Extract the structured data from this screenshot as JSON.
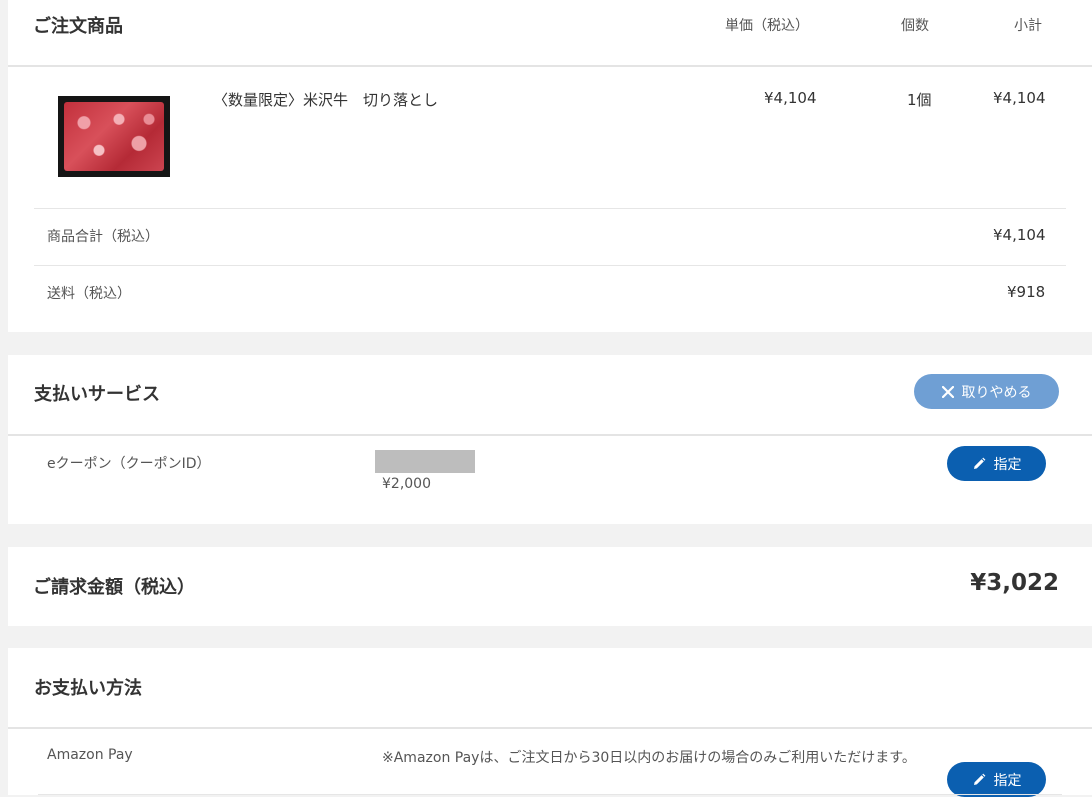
{
  "order_items": {
    "title": "ご注文商品",
    "col_unit_price": "単価（税込）",
    "col_qty": "個数",
    "col_subtotal": "小計",
    "item": {
      "name": "〈数量限定〉米沢牛　切り落とし",
      "unit_price": "¥4,104",
      "qty": "1個",
      "subtotal": "¥4,104"
    },
    "goods_total_label": "商品合計（税込）",
    "goods_total_value": "¥4,104",
    "shipping_label": "送料（税込）",
    "shipping_value": "¥918"
  },
  "payment_service": {
    "title": "支払いサービス",
    "cancel_label": "取りやめる",
    "coupon_label": "eクーポン（クーポンID）",
    "coupon_amount": "¥2,000",
    "assign_label": "指定"
  },
  "billing": {
    "label": "ご請求金額（税込）",
    "value": "¥3,022"
  },
  "payment_method": {
    "title": "お支払い方法",
    "method_label": "Amazon Pay",
    "note": "※Amazon Payは、ご注文日から30日以内のお届けの場合のみご利用いただけます。",
    "assign_label": "指定"
  },
  "colors": {
    "primary_button": "#0b5fb0",
    "cancel_button": "#6f9fd4",
    "page_bg": "#f2f2f2"
  },
  "icons": {
    "cancel": "close-icon",
    "assign": "pencil-icon"
  }
}
